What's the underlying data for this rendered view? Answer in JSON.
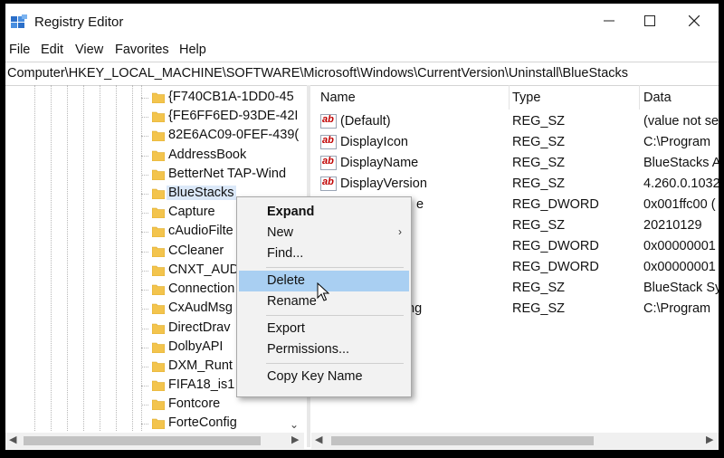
{
  "window": {
    "title": "Registry Editor"
  },
  "menubar": [
    "File",
    "Edit",
    "View",
    "Favorites",
    "Help"
  ],
  "address": "Computer\\HKEY_LOCAL_MACHINE\\SOFTWARE\\Microsoft\\Windows\\CurrentVersion\\Uninstall\\BlueStacks",
  "tree": {
    "items": [
      "{F740CB1A-1DD0-45",
      "{FE6FF6ED-93DE-42I",
      "82E6AC09-0FEF-439(",
      "AddressBook",
      "BetterNet TAP-Wind",
      "BlueStacks",
      "Capture",
      "cAudioFilte",
      "CCleaner",
      "CNXT_AUD",
      "Connection",
      "CxAudMsg",
      "DirectDrav",
      "DolbyAPI",
      "DXM_Runt",
      "FIFA18_is1",
      "Fontcore",
      "ForteConfig"
    ],
    "selected_index": 5
  },
  "list": {
    "headers": {
      "name": "Name",
      "type": "Type",
      "data": "Data"
    },
    "rows": [
      {
        "name": "(Default)",
        "type": "REG_SZ",
        "data": "(value not se"
      },
      {
        "name": "DisplayIcon",
        "type": "REG_SZ",
        "data": "C:\\Program"
      },
      {
        "name": "DisplayName",
        "type": "REG_SZ",
        "data": "BlueStacks A"
      },
      {
        "name": "DisplayVersion",
        "type": "REG_SZ",
        "data": "4.260.0.1032"
      },
      {
        "name": "e",
        "type": "REG_DWORD",
        "data": "0x001ffc00 ("
      },
      {
        "name": "",
        "type": "REG_SZ",
        "data": "20210129"
      },
      {
        "name": "",
        "type": "REG_DWORD",
        "data": "0x00000001"
      },
      {
        "name": "",
        "type": "REG_DWORD",
        "data": "0x00000001"
      },
      {
        "name": "",
        "type": "REG_SZ",
        "data": "BlueStack Sy"
      },
      {
        "name": "ng",
        "type": "REG_SZ",
        "data": "C:\\Program"
      }
    ]
  },
  "context_menu": {
    "items": [
      {
        "label": "Expand",
        "bold": true
      },
      {
        "label": "New",
        "submenu": true
      },
      {
        "label": "Find..."
      },
      {
        "label": "Delete",
        "hover": true
      },
      {
        "label": "Rename"
      },
      {
        "label": "Export"
      },
      {
        "label": "Permissions..."
      },
      {
        "label": "Copy Key Name"
      }
    ]
  },
  "colors": {
    "selection": "#dbe8f8",
    "menu_hover": "#a9cff2",
    "folder": "#f3c44d",
    "string_icon_text": "#c00000"
  },
  "icons": {
    "app": "registry-editor-icon",
    "folder": "folder-icon",
    "string_value": "reg-sz-icon"
  }
}
